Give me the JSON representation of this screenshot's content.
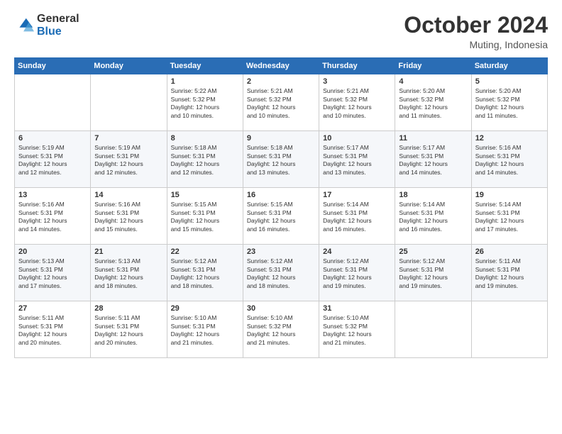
{
  "logo": {
    "general": "General",
    "blue": "Blue"
  },
  "header": {
    "month": "October 2024",
    "location": "Muting, Indonesia"
  },
  "weekdays": [
    "Sunday",
    "Monday",
    "Tuesday",
    "Wednesday",
    "Thursday",
    "Friday",
    "Saturday"
  ],
  "weeks": [
    [
      {
        "day": "",
        "info": ""
      },
      {
        "day": "",
        "info": ""
      },
      {
        "day": "1",
        "info": "Sunrise: 5:22 AM\nSunset: 5:32 PM\nDaylight: 12 hours\nand 10 minutes."
      },
      {
        "day": "2",
        "info": "Sunrise: 5:21 AM\nSunset: 5:32 PM\nDaylight: 12 hours\nand 10 minutes."
      },
      {
        "day": "3",
        "info": "Sunrise: 5:21 AM\nSunset: 5:32 PM\nDaylight: 12 hours\nand 10 minutes."
      },
      {
        "day": "4",
        "info": "Sunrise: 5:20 AM\nSunset: 5:32 PM\nDaylight: 12 hours\nand 11 minutes."
      },
      {
        "day": "5",
        "info": "Sunrise: 5:20 AM\nSunset: 5:32 PM\nDaylight: 12 hours\nand 11 minutes."
      }
    ],
    [
      {
        "day": "6",
        "info": "Sunrise: 5:19 AM\nSunset: 5:31 PM\nDaylight: 12 hours\nand 12 minutes."
      },
      {
        "day": "7",
        "info": "Sunrise: 5:19 AM\nSunset: 5:31 PM\nDaylight: 12 hours\nand 12 minutes."
      },
      {
        "day": "8",
        "info": "Sunrise: 5:18 AM\nSunset: 5:31 PM\nDaylight: 12 hours\nand 12 minutes."
      },
      {
        "day": "9",
        "info": "Sunrise: 5:18 AM\nSunset: 5:31 PM\nDaylight: 12 hours\nand 13 minutes."
      },
      {
        "day": "10",
        "info": "Sunrise: 5:17 AM\nSunset: 5:31 PM\nDaylight: 12 hours\nand 13 minutes."
      },
      {
        "day": "11",
        "info": "Sunrise: 5:17 AM\nSunset: 5:31 PM\nDaylight: 12 hours\nand 14 minutes."
      },
      {
        "day": "12",
        "info": "Sunrise: 5:16 AM\nSunset: 5:31 PM\nDaylight: 12 hours\nand 14 minutes."
      }
    ],
    [
      {
        "day": "13",
        "info": "Sunrise: 5:16 AM\nSunset: 5:31 PM\nDaylight: 12 hours\nand 14 minutes."
      },
      {
        "day": "14",
        "info": "Sunrise: 5:16 AM\nSunset: 5:31 PM\nDaylight: 12 hours\nand 15 minutes."
      },
      {
        "day": "15",
        "info": "Sunrise: 5:15 AM\nSunset: 5:31 PM\nDaylight: 12 hours\nand 15 minutes."
      },
      {
        "day": "16",
        "info": "Sunrise: 5:15 AM\nSunset: 5:31 PM\nDaylight: 12 hours\nand 16 minutes."
      },
      {
        "day": "17",
        "info": "Sunrise: 5:14 AM\nSunset: 5:31 PM\nDaylight: 12 hours\nand 16 minutes."
      },
      {
        "day": "18",
        "info": "Sunrise: 5:14 AM\nSunset: 5:31 PM\nDaylight: 12 hours\nand 16 minutes."
      },
      {
        "day": "19",
        "info": "Sunrise: 5:14 AM\nSunset: 5:31 PM\nDaylight: 12 hours\nand 17 minutes."
      }
    ],
    [
      {
        "day": "20",
        "info": "Sunrise: 5:13 AM\nSunset: 5:31 PM\nDaylight: 12 hours\nand 17 minutes."
      },
      {
        "day": "21",
        "info": "Sunrise: 5:13 AM\nSunset: 5:31 PM\nDaylight: 12 hours\nand 18 minutes."
      },
      {
        "day": "22",
        "info": "Sunrise: 5:12 AM\nSunset: 5:31 PM\nDaylight: 12 hours\nand 18 minutes."
      },
      {
        "day": "23",
        "info": "Sunrise: 5:12 AM\nSunset: 5:31 PM\nDaylight: 12 hours\nand 18 minutes."
      },
      {
        "day": "24",
        "info": "Sunrise: 5:12 AM\nSunset: 5:31 PM\nDaylight: 12 hours\nand 19 minutes."
      },
      {
        "day": "25",
        "info": "Sunrise: 5:12 AM\nSunset: 5:31 PM\nDaylight: 12 hours\nand 19 minutes."
      },
      {
        "day": "26",
        "info": "Sunrise: 5:11 AM\nSunset: 5:31 PM\nDaylight: 12 hours\nand 19 minutes."
      }
    ],
    [
      {
        "day": "27",
        "info": "Sunrise: 5:11 AM\nSunset: 5:31 PM\nDaylight: 12 hours\nand 20 minutes."
      },
      {
        "day": "28",
        "info": "Sunrise: 5:11 AM\nSunset: 5:31 PM\nDaylight: 12 hours\nand 20 minutes."
      },
      {
        "day": "29",
        "info": "Sunrise: 5:10 AM\nSunset: 5:31 PM\nDaylight: 12 hours\nand 21 minutes."
      },
      {
        "day": "30",
        "info": "Sunrise: 5:10 AM\nSunset: 5:32 PM\nDaylight: 12 hours\nand 21 minutes."
      },
      {
        "day": "31",
        "info": "Sunrise: 5:10 AM\nSunset: 5:32 PM\nDaylight: 12 hours\nand 21 minutes."
      },
      {
        "day": "",
        "info": ""
      },
      {
        "day": "",
        "info": ""
      }
    ]
  ]
}
